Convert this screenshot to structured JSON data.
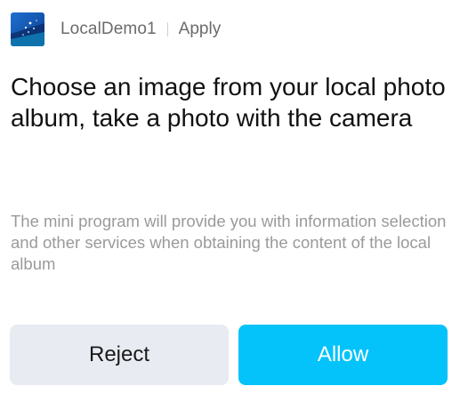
{
  "header": {
    "app_name": "LocalDemo1",
    "action_label": "Apply",
    "logo_icon": "app-logo-icon"
  },
  "prompt": {
    "title": "Choose an image from your local photo album, take a photo with the camera",
    "description": "The mini program will provide you with information selection and other services when obtaining the content of the local album"
  },
  "buttons": {
    "reject_label": "Reject",
    "allow_label": "Allow"
  },
  "colors": {
    "allow_bg": "#03c3fa",
    "reject_bg": "#e8ebf1",
    "title_text": "#111111",
    "secondary_text": "#9a9a9a"
  }
}
